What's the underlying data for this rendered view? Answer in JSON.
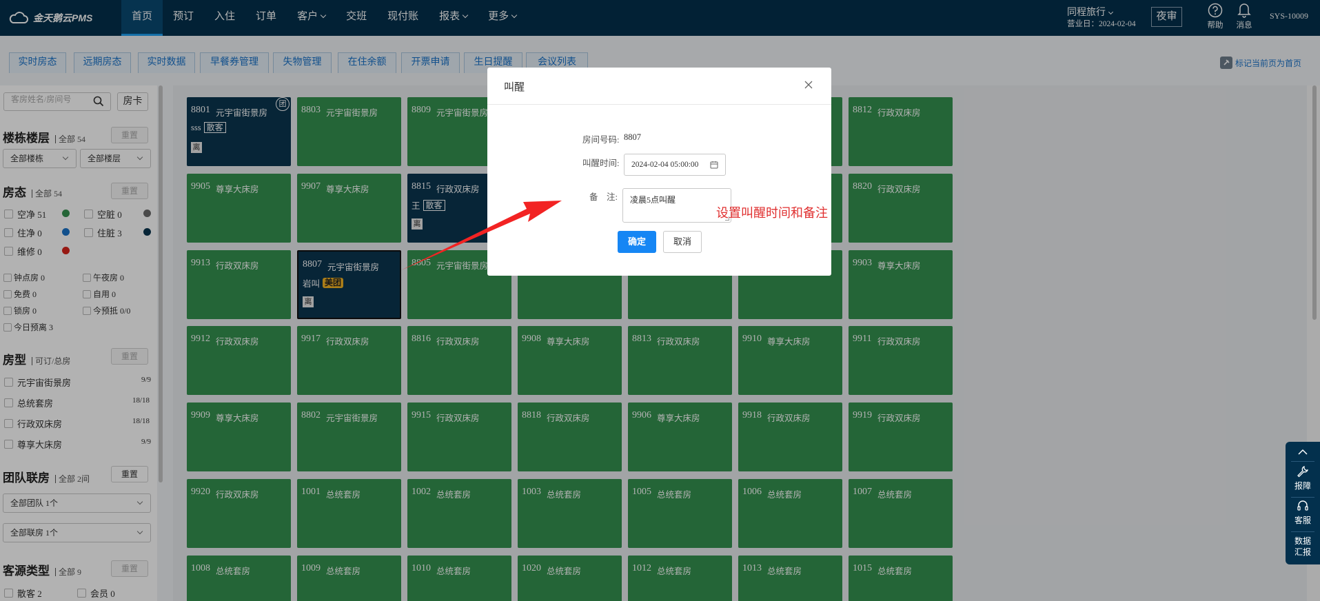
{
  "nav": {
    "logo": "金天鹅云PMS",
    "items": [
      "首页",
      "预订",
      "入住",
      "订单",
      "客户",
      "交班",
      "现付账",
      "报表",
      "更多"
    ],
    "hotel": "同程旅行",
    "business_date": "营业日：2024-02-04",
    "night_audit": "夜审",
    "help": "帮助",
    "messages": "消息",
    "user": "SYS-10009"
  },
  "tabs": [
    "实时房态",
    "远期房态",
    "实时数据",
    "早餐券管理",
    "失物管理",
    "在住余额",
    "开票申请",
    "生日提醒",
    "会议列表"
  ],
  "pin_label": "标记当前页为首页",
  "sidebar": {
    "search_placeholder": "客房姓名/房间号",
    "card_button": "房卡",
    "building": {
      "title": "楼栋楼层",
      "sub": "全部 54",
      "reset": "重置",
      "sel1": "全部楼栋",
      "sel2": "全部楼层"
    },
    "status": {
      "title": "房态",
      "sub": "全部 54",
      "reset": "重置",
      "items": [
        "空净 51",
        "空脏 0",
        "住净 0",
        "住脏 3",
        "维修 0"
      ],
      "colors": [
        "#34914f",
        "#6b6b6b",
        "#1a73c9",
        "#0b3550",
        "#d9241c"
      ],
      "flags": [
        "钟点房 0",
        "午夜房 0",
        "免费 0",
        "自用 0",
        "锁房 0",
        "今预抵 0/0",
        "今日预离 3"
      ]
    },
    "roomtype": {
      "title": "房型",
      "sub": "可订/总房",
      "reset": "重置",
      "items": [
        {
          "name": "元宇宙街景房",
          "count": "9/9"
        },
        {
          "name": "总统套房",
          "count": "18/18"
        },
        {
          "name": "行政双床房",
          "count": "18/18"
        },
        {
          "name": "尊享大床房",
          "count": "9/9"
        }
      ]
    },
    "group": {
      "title": "团队联房",
      "sub": "全部 2间",
      "reset": "重置",
      "sel1": "全部团队 1个",
      "sel2": "全部联房 1个"
    },
    "source": {
      "title": "客源类型",
      "sub": "全部 9",
      "reset": "重置",
      "items": [
        "散客 2",
        "会员 0"
      ]
    }
  },
  "rooms": [
    [
      {
        "num": "8801",
        "type": "元宇宙街景房",
        "occ": true,
        "guest": "sss",
        "tag": "散客",
        "leave": "离",
        "tuan": "团"
      },
      {
        "num": "8803",
        "type": "元宇宙街景房"
      },
      {
        "num": "8809",
        "type": "元宇宙街景房"
      },
      {
        "num": "",
        "type": ""
      },
      {
        "num": "",
        "type": ""
      },
      {
        "num": "",
        "type": ""
      },
      {
        "num": "8812",
        "type": "行政双床房"
      }
    ],
    [
      {
        "num": "9905",
        "type": "尊享大床房"
      },
      {
        "num": "9907",
        "type": "尊享大床房"
      },
      {
        "num": "8815",
        "type": "行政双床房",
        "occ": true,
        "guest": "王",
        "tag": "散客",
        "leave": "离"
      },
      {
        "num": "",
        "type": ""
      },
      {
        "num": "",
        "type": ""
      },
      {
        "num": "",
        "type": ""
      },
      {
        "num": "8820",
        "type": "行政双床房"
      }
    ],
    [
      {
        "num": "9913",
        "type": "行政双床房"
      },
      {
        "num": "8807",
        "type": "元宇宙街景房",
        "occ": true,
        "selected": true,
        "guest": "岩叫",
        "gold": "美团",
        "leave": "离"
      },
      {
        "num": "8805",
        "type": "元宇宙街景房"
      },
      {
        "num": "",
        "type": ""
      },
      {
        "num": "",
        "type": ""
      },
      {
        "num": "",
        "type": ""
      },
      {
        "num": "9903",
        "type": "尊享大床房"
      }
    ],
    [
      {
        "num": "9912",
        "type": "行政双床房"
      },
      {
        "num": "9917",
        "type": "行政双床房"
      },
      {
        "num": "8816",
        "type": "行政双床房"
      },
      {
        "num": "9908",
        "type": "尊享大床房"
      },
      {
        "num": "8813",
        "type": "行政双床房"
      },
      {
        "num": "9910",
        "type": "尊享大床房"
      },
      {
        "num": "9911",
        "type": "行政双床房"
      }
    ],
    [
      {
        "num": "9909",
        "type": "尊享大床房"
      },
      {
        "num": "8802",
        "type": "元宇宙街景房"
      },
      {
        "num": "9915",
        "type": "行政双床房"
      },
      {
        "num": "8818",
        "type": "行政双床房"
      },
      {
        "num": "9906",
        "type": "尊享大床房"
      },
      {
        "num": "9918",
        "type": "行政双床房"
      },
      {
        "num": "9919",
        "type": "行政双床房"
      }
    ],
    [
      {
        "num": "9920",
        "type": "行政双床房"
      },
      {
        "num": "1001",
        "type": "总统套房"
      },
      {
        "num": "1002",
        "type": "总统套房"
      },
      {
        "num": "1003",
        "type": "总统套房"
      },
      {
        "num": "1005",
        "type": "总统套房"
      },
      {
        "num": "1006",
        "type": "总统套房"
      },
      {
        "num": "1007",
        "type": "总统套房"
      }
    ],
    [
      {
        "num": "1008",
        "type": "总统套房"
      },
      {
        "num": "1009",
        "type": "总统套房"
      },
      {
        "num": "1010",
        "type": "总统套房"
      },
      {
        "num": "1020",
        "type": "总统套房"
      },
      {
        "num": "1012",
        "type": "总统套房"
      },
      {
        "num": "1013",
        "type": "总统套房"
      },
      {
        "num": "1015",
        "type": "总统套房"
      }
    ]
  ],
  "modal": {
    "title": "叫醒",
    "room_label": "房间号码:",
    "room_value": "8807",
    "time_label": "叫醒时间:",
    "time_value": "2024-02-04 05:00:00",
    "remark_label": "备　注:",
    "remark_value": "凌晨5点叫醒",
    "ok": "确定",
    "cancel": "取消"
  },
  "annotation": "设置叫醒时间和备注",
  "float_panel": [
    "报障",
    "客服",
    "数据",
    "汇报"
  ],
  "colors": {
    "nav_bg": "#03304d",
    "vacant": "#34914f",
    "occupied": "#0b3550",
    "primary": "#1686f4",
    "annotation": "#e03030"
  }
}
